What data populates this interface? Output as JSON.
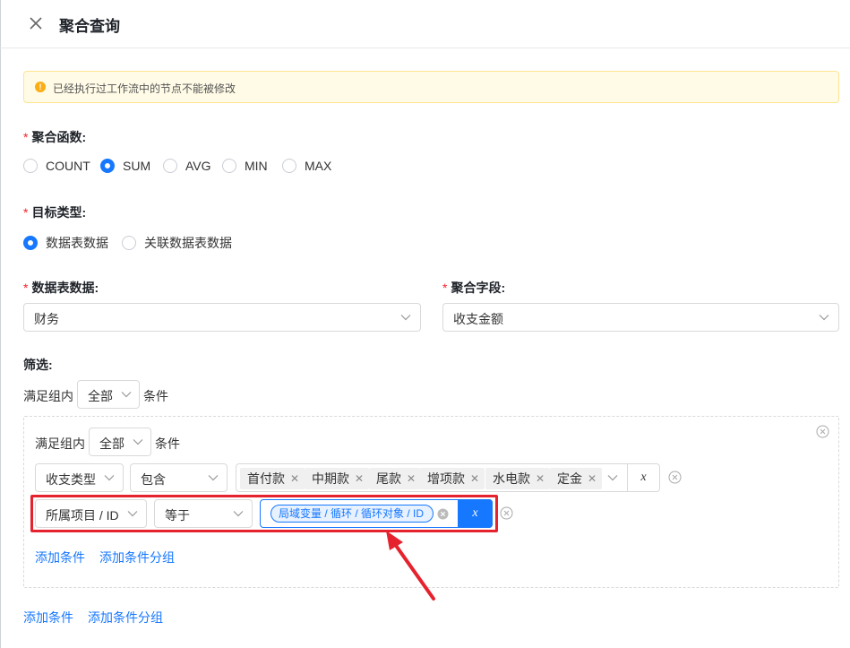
{
  "header": {
    "title": "聚合查询"
  },
  "notice": {
    "text": "已经执行过工作流中的节点不能被修改"
  },
  "aggregate_function": {
    "label": "聚合函数:",
    "options": [
      "COUNT",
      "SUM",
      "AVG",
      "MIN",
      "MAX"
    ],
    "selected": "SUM"
  },
  "target_type": {
    "label": "目标类型:",
    "options": [
      "数据表数据",
      "关联数据表数据"
    ],
    "selected": "数据表数据"
  },
  "table_data": {
    "label": "数据表数据:",
    "value": "财务"
  },
  "aggregate_field": {
    "label": "聚合字段:",
    "value": "收支金额"
  },
  "filter": {
    "label": "筛选:",
    "prefix": "满足组内",
    "mode": "全部",
    "suffix": "条件",
    "group": {
      "prefix": "满足组内",
      "mode": "全部",
      "suffix": "条件",
      "conditions": [
        {
          "field": "收支类型",
          "operator": "包含",
          "values": [
            "首付款",
            "中期款",
            "尾款",
            "增项款",
            "水电款",
            "定金"
          ],
          "var_symbol": "x"
        },
        {
          "field": "所属项目 / ID",
          "operator": "等于",
          "variable": "局域变量 / 循环 / 循环对象 / ID",
          "var_symbol": "x"
        }
      ],
      "add_condition": "添加条件",
      "add_group": "添加条件分组"
    },
    "add_condition": "添加条件",
    "add_group": "添加条件分组"
  },
  "colors": {
    "primary": "#1677ff",
    "required": "#f5222d",
    "highlight": "#e5222d",
    "warning": "#faad14"
  }
}
